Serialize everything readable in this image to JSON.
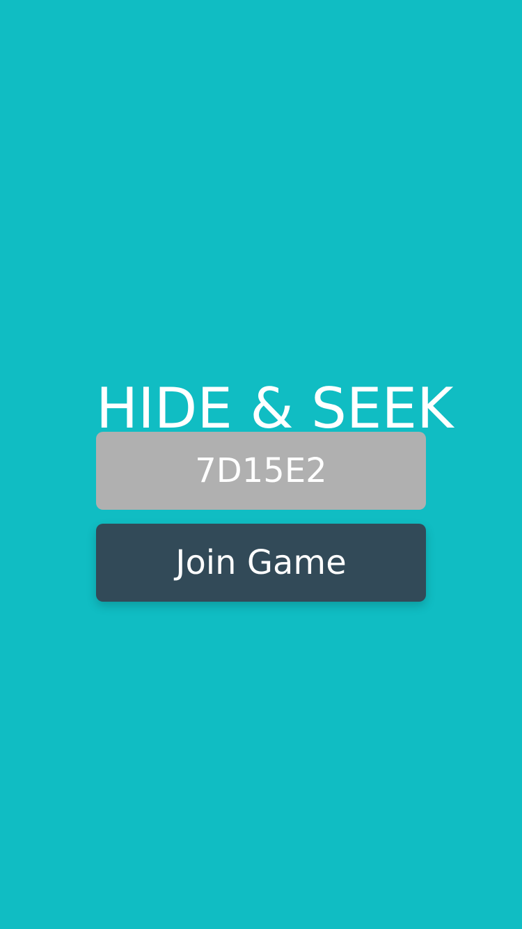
{
  "app": {
    "title": "HIDE & SEEK"
  },
  "form": {
    "game_code_value": "7D15E2",
    "join_button_label": "Join Game"
  },
  "colors": {
    "background": "#10BDC3",
    "input_background": "#B0B0B0",
    "button_background": "#324A58",
    "text": "#FFFFFF"
  }
}
